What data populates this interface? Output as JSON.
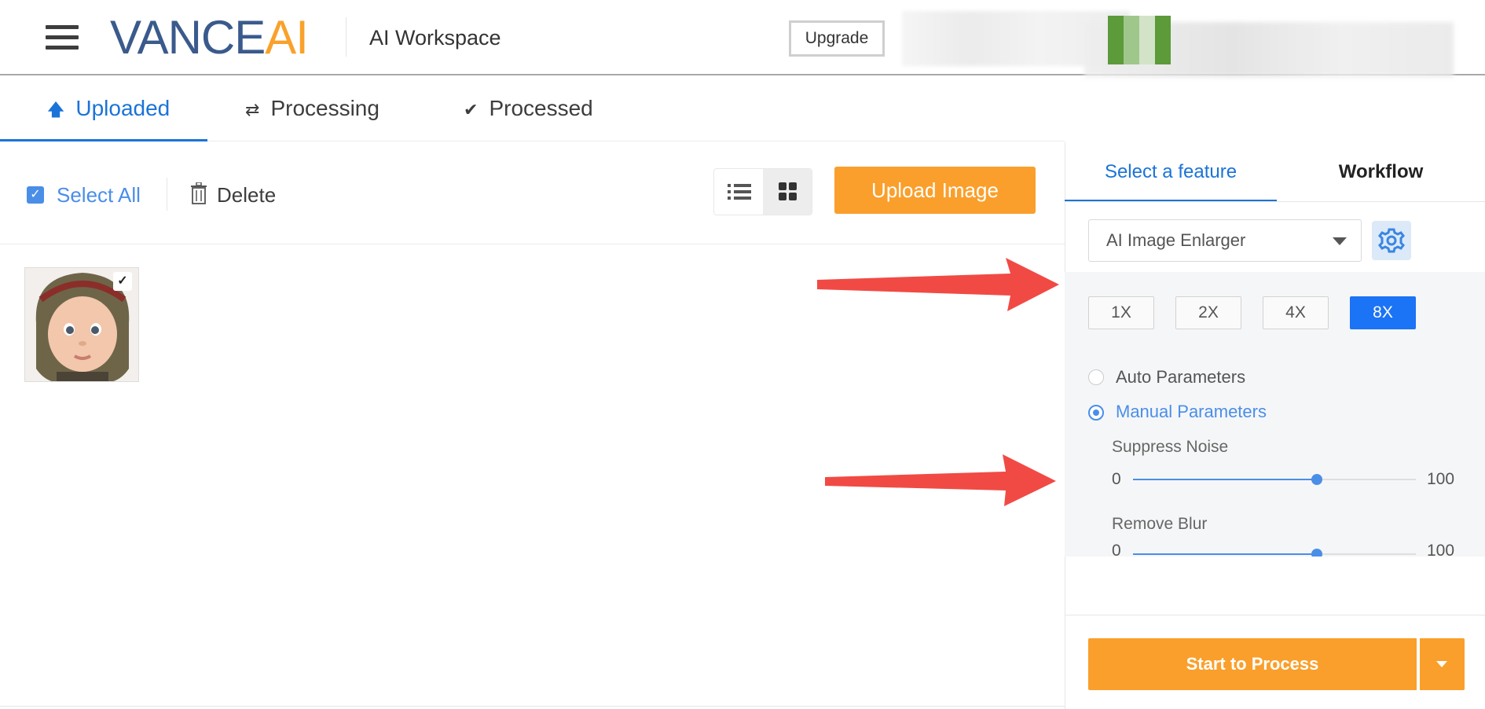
{
  "header": {
    "logo_part1": "VANCE",
    "logo_part2": "AI",
    "workspace_title": "AI Workspace",
    "upgrade_label": "Upgrade"
  },
  "tabs": [
    {
      "label": "Uploaded",
      "active": true
    },
    {
      "label": "Processing",
      "active": false
    },
    {
      "label": "Processed",
      "active": false
    }
  ],
  "toolbar": {
    "select_all_label": "Select All",
    "delete_label": "Delete",
    "upload_label": "Upload Image",
    "view_mode": "grid"
  },
  "images": [
    {
      "name": "baby-photo",
      "selected": true
    }
  ],
  "panel": {
    "tab_feature": "Select a feature",
    "tab_workflow": "Workflow",
    "feature_selected": "AI Image Enlarger",
    "scales": [
      "1X",
      "2X",
      "4X",
      "8X"
    ],
    "active_scale": "8X",
    "auto_params_label": "Auto Parameters",
    "manual_params_label": "Manual Parameters",
    "params_mode": "manual",
    "sliders": [
      {
        "label": "Suppress Noise",
        "min": "0",
        "max": "100",
        "value": 65
      },
      {
        "label": "Remove Blur",
        "min": "0",
        "max": "100",
        "value": 65
      }
    ],
    "start_label": "Start to Process"
  },
  "colors": {
    "accent_blue": "#1b73d8",
    "orange": "#fa9f2b",
    "annotation_red": "#f14a44"
  }
}
